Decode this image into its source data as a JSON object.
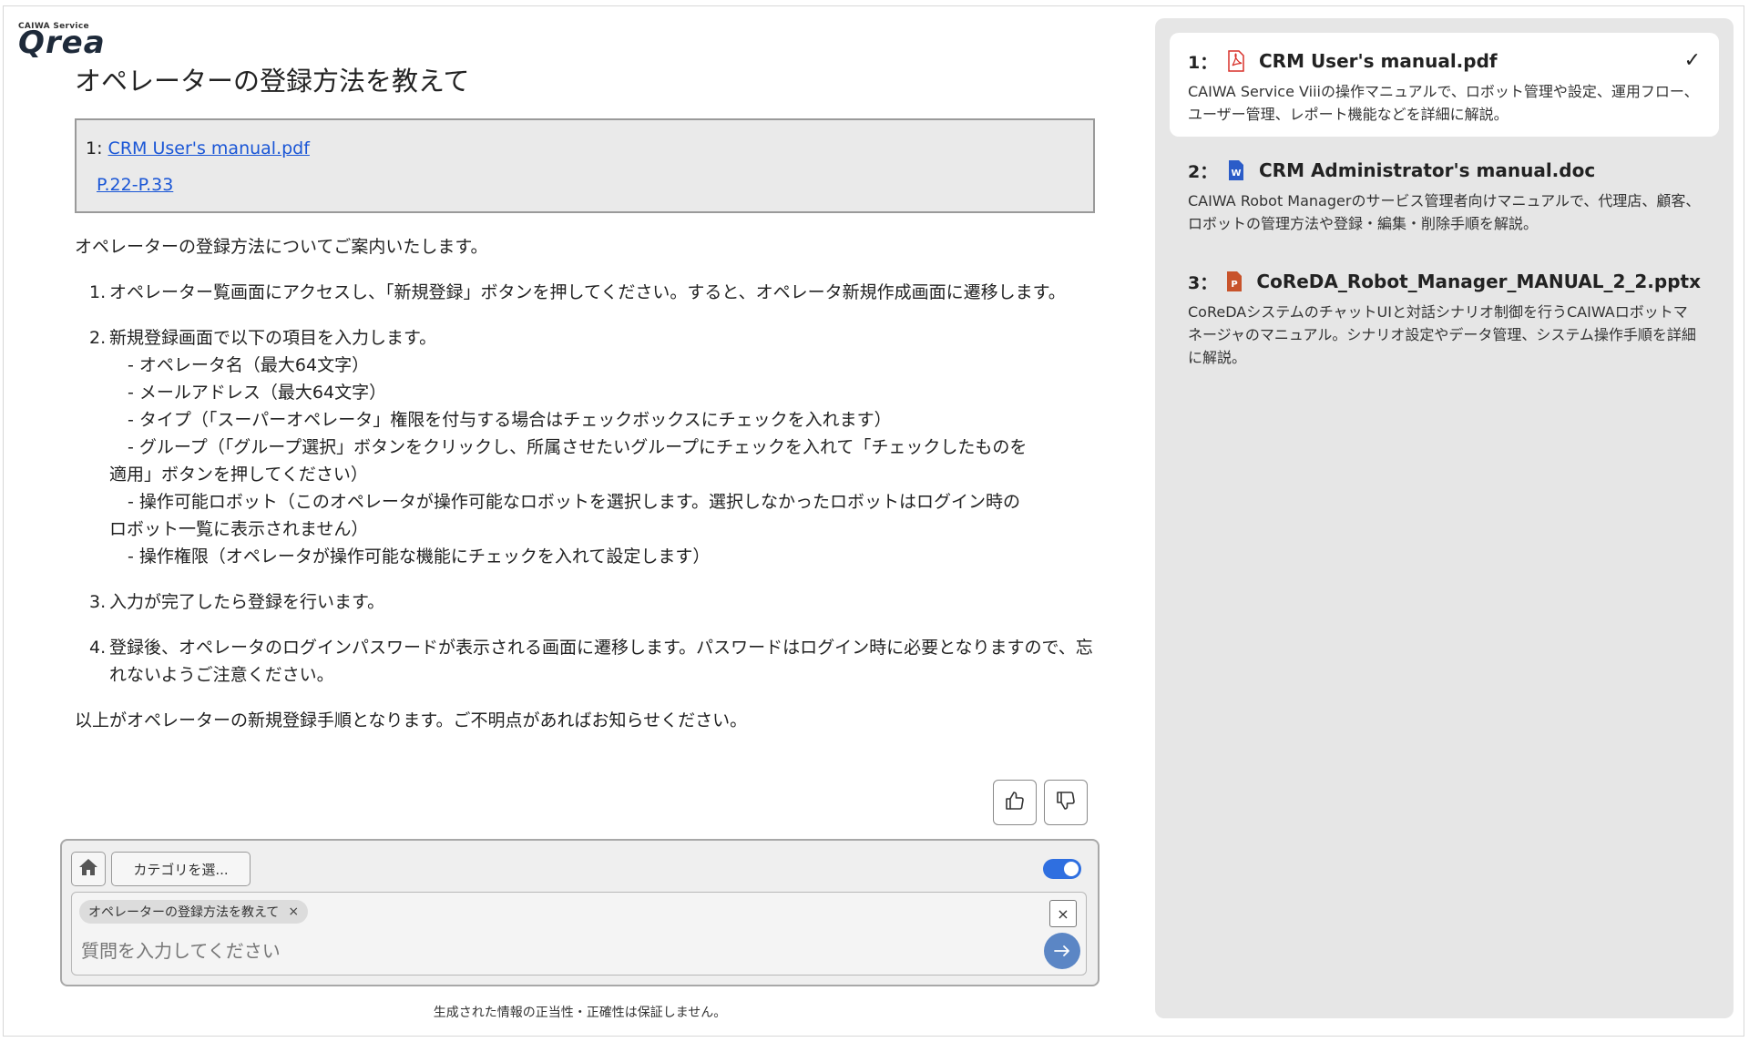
{
  "logo": {
    "top_text": "CAIWA Service",
    "main_text": "Qrea"
  },
  "title": "オペレーターの登録方法を教えて",
  "reference": {
    "index": "1:",
    "file": "CRM User's manual.pdf",
    "pages": "P.22-P.33"
  },
  "answer": {
    "intro": "オペレーターの登録方法についてご案内いたします。",
    "steps": [
      {
        "num": "1.",
        "text": "オペレーター覧画面にアクセスし、「新規登録」ボタンを押してください。すると、オペレータ新規作成画面に遷移します。"
      },
      {
        "num": "2.",
        "text": "新規登録画面で以下の項目を入力します。",
        "sub": [
          "- オペレータ名（最大64文字）",
          "- メールアドレス（最大64文字）",
          "- タイプ（「スーパーオペレータ」権限を付与する場合はチェックボックスにチェックを入れます）",
          "- グループ（「グループ選択」ボタンをクリックし、所属させたいグループにチェックを入れて「チェックしたものを",
          "適用」ボタンを押してください）",
          "- 操作可能ロボット（このオペレータが操作可能なロボットを選択します。選択しなかったロボットはログイン時の",
          "ロボット一覧に表示されません）",
          "- 操作権限（オペレータが操作可能な機能にチェックを入れて設定します）"
        ]
      },
      {
        "num": "3.",
        "text": "入力が完了したら登録を行います。"
      },
      {
        "num": "4.",
        "text": "登録後、オペレータのログインパスワードが表示される画面に遷移します。パスワードはログイン時に必要となりますので、忘れないようご注意ください。"
      }
    ],
    "outro": "以上がオペレーターの新規登録手順となります。ご不明点があればお知らせください。"
  },
  "feedback": {
    "like_icon": "thumbs-up-icon",
    "dislike_icon": "thumbs-down-icon"
  },
  "input_area": {
    "home_icon": "home-icon",
    "category_button": "カテゴリを選...",
    "toggle_on": true,
    "chip_text": "オペレーターの登録方法を教えて",
    "chip_close": "×",
    "clear_button": "×",
    "placeholder": "質問を入力してください",
    "send_icon": "arrow-right-icon"
  },
  "disclaimer": "生成された情報の正当性・正確性は保証しません。",
  "documents": [
    {
      "num": "1：",
      "type": "pdf",
      "icon": "pdf-icon",
      "title": "CRM User's manual.pdf",
      "selected": true,
      "desc": "CAIWA Service Viiiの操作マニュアルで、ロボット管理や設定、運用フロー、ユーザー管理、レポート機能などを詳細に解説。"
    },
    {
      "num": "2：",
      "type": "doc",
      "icon": "word-icon",
      "title": "CRM Administrator's manual.doc",
      "selected": false,
      "desc": "CAIWA Robot Managerのサービス管理者向けマニュアルで、代理店、顧客、ロボットの管理方法や登録・編集・削除手順を解説。"
    },
    {
      "num": "3：",
      "type": "pptx",
      "icon": "powerpoint-icon",
      "title": "CoReDA_Robot_Manager_MANUAL_2_2.pptx",
      "selected": false,
      "desc": "CoReDAシステムのチャットUIと対話シナリオ制御を行うCAIWAロボットマネージャのマニュアル。シナリオ設定やデータ管理、システム操作手順を詳細に解説。"
    }
  ],
  "colors": {
    "accent": "#2f6fe0",
    "send": "#5b86c5",
    "link": "#1a56d6",
    "pdf": "#d8312a",
    "word": "#2b5cc8",
    "ppt": "#c8532b"
  }
}
